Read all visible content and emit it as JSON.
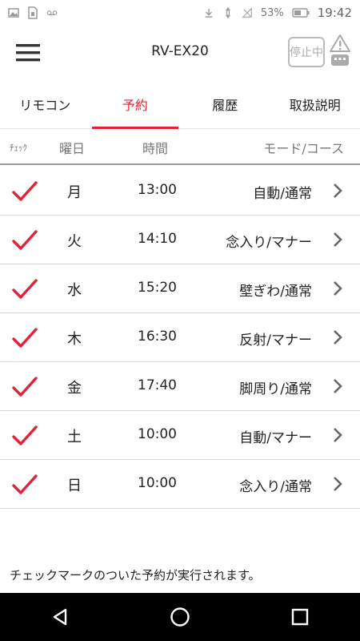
{
  "status_bar": {
    "battery_percent": "53%",
    "time": "19:42",
    "left_icons": [
      "image-icon",
      "sim-card-icon",
      "voicemail-icon"
    ],
    "right_icons": [
      "download-icon",
      "data-arrows-icon",
      "no-signal-icon",
      "battery-icon"
    ]
  },
  "app_bar": {
    "title": "RV-EX20",
    "stop_label": "停止中",
    "menu_icon": "hamburger-menu-icon",
    "warning_icon": "warning-icon"
  },
  "tabs": [
    {
      "label": "リモコン",
      "active": false
    },
    {
      "label": "予約",
      "active": true
    },
    {
      "label": "履歴",
      "active": false
    },
    {
      "label": "取扱説明",
      "active": false
    }
  ],
  "columns": {
    "check": "ﾁｪｯｸ",
    "day": "曜日",
    "time": "時間",
    "mode": "モード/コース"
  },
  "schedule": [
    {
      "checked": true,
      "day": "月",
      "time": "13:00",
      "mode": "自動/通常"
    },
    {
      "checked": true,
      "day": "火",
      "time": "14:10",
      "mode": "念入り/マナー"
    },
    {
      "checked": true,
      "day": "水",
      "time": "15:20",
      "mode": "壁ぎわ/通常"
    },
    {
      "checked": true,
      "day": "木",
      "time": "16:30",
      "mode": "反射/マナー"
    },
    {
      "checked": true,
      "day": "金",
      "time": "17:40",
      "mode": "脚周り/通常"
    },
    {
      "checked": true,
      "day": "土",
      "time": "10:00",
      "mode": "自動/マナー"
    },
    {
      "checked": true,
      "day": "日",
      "time": "10:00",
      "mode": "念入り/通常"
    }
  ],
  "footnote": "チェックマークのついた予約が実行されます。",
  "colors": {
    "accent": "#e0233a",
    "navbar": "#000000"
  },
  "nav": [
    "back-icon",
    "home-icon",
    "recents-icon"
  ]
}
